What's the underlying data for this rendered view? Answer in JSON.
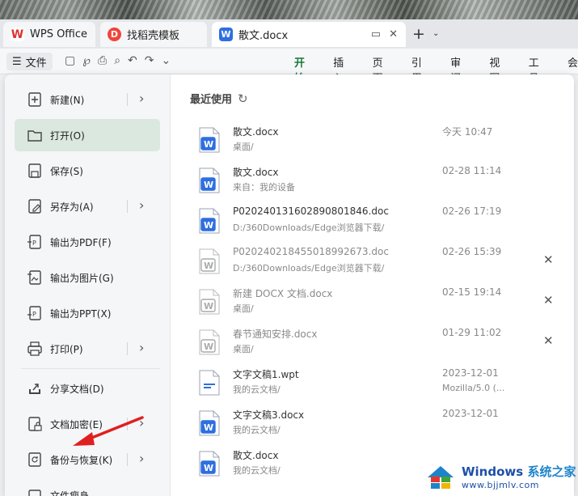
{
  "tabs": {
    "wps": "WPS Office",
    "template": "找稻壳模板",
    "doc": "散文.docx"
  },
  "toolbar": {
    "file_label": "文件",
    "ribbon": [
      "开始",
      "插入",
      "页面",
      "引用",
      "审阅",
      "视图",
      "工具",
      "会"
    ]
  },
  "menu": {
    "items": [
      {
        "label": "新建(N)",
        "icon": "new-doc-icon",
        "has_submenu": true
      },
      {
        "label": "打开(O)",
        "icon": "folder-icon",
        "has_submenu": false,
        "active": true
      },
      {
        "label": "保存(S)",
        "icon": "save-icon",
        "has_submenu": false
      },
      {
        "label": "另存为(A)",
        "icon": "save-as-icon",
        "has_submenu": true
      },
      {
        "label": "输出为PDF(F)",
        "icon": "export-pdf-icon",
        "has_submenu": false
      },
      {
        "label": "输出为图片(G)",
        "icon": "export-image-icon",
        "has_submenu": false
      },
      {
        "label": "输出为PPT(X)",
        "icon": "export-ppt-icon",
        "has_submenu": false
      },
      {
        "label": "打印(P)",
        "icon": "print-icon",
        "has_submenu": true
      },
      {
        "label": "分享文档(D)",
        "icon": "share-icon",
        "has_submenu": false
      },
      {
        "label": "文档加密(E)",
        "icon": "lock-doc-icon",
        "has_submenu": true
      },
      {
        "label": "备份与恢复(K)",
        "icon": "backup-icon",
        "has_submenu": true
      },
      {
        "label": "文件瘦身",
        "icon": "slim-icon",
        "has_submenu": false
      }
    ]
  },
  "recent": {
    "title": "最近使用",
    "files": [
      {
        "name": "散文.docx",
        "path": "桌面/",
        "date": "今天 10:47",
        "date2": "",
        "type": "docx",
        "closable": false,
        "dim": false
      },
      {
        "name": "散文.docx",
        "path": "来自：我的设备",
        "date": "02-28 11:14",
        "date2": "",
        "type": "docx",
        "closable": false,
        "dim": false
      },
      {
        "name": "P020240131602890801846.doc",
        "path": "D:/360Downloads/Edge浏览器下载/",
        "date": "02-26 17:19",
        "date2": "",
        "type": "doc",
        "closable": false,
        "dim": false
      },
      {
        "name": "P020240218455018992673.doc",
        "path": "D:/360Downloads/Edge浏览器下载/",
        "date": "02-26 15:39",
        "date2": "",
        "type": "doc-gray",
        "closable": true,
        "dim": true
      },
      {
        "name": "新建 DOCX 文档.docx",
        "path": "桌面/",
        "date": "02-15 19:14",
        "date2": "",
        "type": "docx-gray",
        "closable": true,
        "dim": true
      },
      {
        "name": "春节通知安排.docx",
        "path": "桌面/",
        "date": "01-29 11:02",
        "date2": "",
        "type": "docx-gray",
        "closable": true,
        "dim": true
      },
      {
        "name": "文字文稿1.wpt",
        "path": "我的云文档/",
        "date": "2023-12-01",
        "date2": "Mozilla/5.0 (...",
        "type": "wpt",
        "closable": false,
        "dim": false
      },
      {
        "name": "文字文稿3.docx",
        "path": "我的云文档/",
        "date": "2023-12-01",
        "date2": "",
        "type": "docx",
        "closable": false,
        "dim": false
      },
      {
        "name": "散文.docx",
        "path": "我的云文档/",
        "date": "",
        "date2": "",
        "type": "docx",
        "closable": false,
        "dim": false
      }
    ]
  },
  "watermark": {
    "brand": "Windows",
    "brand_suffix": "系统之家",
    "url": "www.bjjmlv.com"
  },
  "colors": {
    "accent_green": "#1a7a3a",
    "word_blue": "#2e6fe0",
    "annotation_red": "#e02020"
  }
}
